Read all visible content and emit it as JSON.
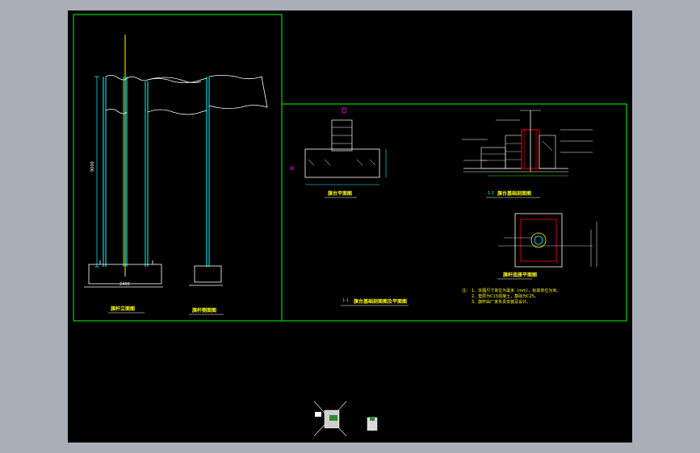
{
  "window": {
    "background_color": "#a9aeb8",
    "canvas_color": "#000000"
  },
  "colors": {
    "frame": "#00ff00",
    "cyan_lines": "#00ffff",
    "white_lines": "#ffffff",
    "yellow_axis": "#ffff00",
    "red_rebar": "#ff0000",
    "magenta_marker": "#ff00ff",
    "title_yellow": "#ffff00"
  },
  "panel_left": {
    "title_front": "旗杆立面图",
    "title_side": "旗杆侧面图",
    "dim_vertical": "9000",
    "dim_base": "2400"
  },
  "panel_right": {
    "plan_title": "旗台平面图",
    "section_title": "旗台基础剖面图",
    "section_prefix": "1-1",
    "plan2_title": "旗杆底座平面图",
    "main_title_prefix": "1-1",
    "main_title": "旗台基础剖面图及平面图",
    "notes_label": "注：",
    "notes": [
      "1、本图尺寸单位为毫米（mm），标高单位为米。",
      "2、垫层为C15混凝土，基础为C25。",
      "3、旗杆由厂家负责安装及设计。"
    ]
  }
}
